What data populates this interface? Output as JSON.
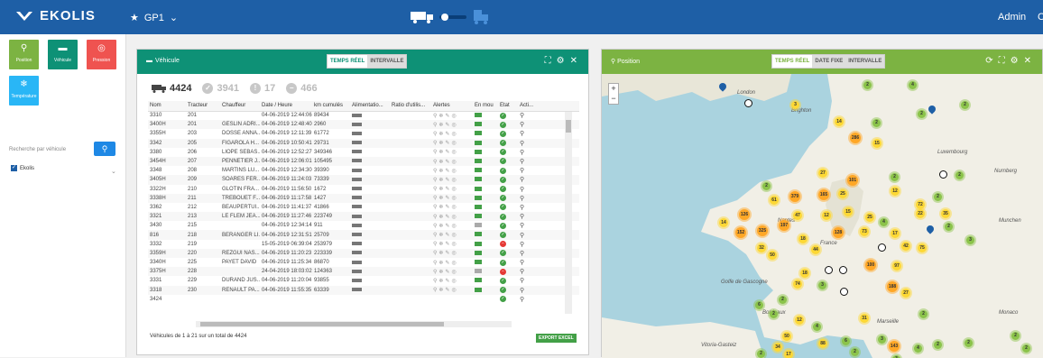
{
  "app": {
    "logo_text": "EKOLIS",
    "favorites": "GP1",
    "user": "Admin",
    "user2": "C"
  },
  "left": {
    "tiles": [
      {
        "label": "Position",
        "color": "#7cb342"
      },
      {
        "label": "Véhicule",
        "color": "#0e9176"
      },
      {
        "label": "Pression",
        "color": "#ef5350"
      },
      {
        "label": "Température",
        "color": "#29b6f6"
      }
    ],
    "search_placeholder": "Recherche par véhicule",
    "group": "Ekolis"
  },
  "vehicles": {
    "title": "Véhicule",
    "tab_realtime": "TEMPS RÉEL",
    "tab_interval": "INTERVALLE",
    "counts": {
      "total": "4424",
      "ok": "3941",
      "alert": "17",
      "off": "466"
    },
    "columns": [
      "Nom",
      "Tracteur",
      "Chauffeur",
      "Date / Heure",
      "km cumulés",
      "Alimentatio...",
      "Ratio d'utilis...",
      "Alertes",
      "En mou",
      "Etat",
      "Acti..."
    ],
    "rows": [
      [
        "3310",
        "201",
        "",
        "04-06-2019 12:44:06",
        "89434",
        "g",
        "ok"
      ],
      [
        "3400H",
        "201",
        "GESLIN ADRI...",
        "04-06-2019 12:48:40",
        "2960",
        "g",
        "ok"
      ],
      [
        "3355H",
        "203",
        "DOSSE ANNA...",
        "04-06-2019 12:11:39",
        "61772",
        "g",
        "ok"
      ],
      [
        "3342",
        "205",
        "FIGAROLA H...",
        "04-06-2019 10:50:41",
        "29731",
        "g",
        "ok"
      ],
      [
        "3380",
        "206",
        "LIOPE SEBAS...",
        "04-06-2019 12:52:27",
        "349346",
        "g",
        "ok"
      ],
      [
        "3454H",
        "207",
        "PENNETIER J...",
        "04-06-2019 12:06:01",
        "105495",
        "g",
        "ok"
      ],
      [
        "3348",
        "208",
        "MARTINS LU...",
        "04-06-2019 12:34:30",
        "39390",
        "g",
        "ok"
      ],
      [
        "3405H",
        "209",
        "SOARES FER...",
        "04-06-2019 11:24:03",
        "73339",
        "g",
        "ok"
      ],
      [
        "3322H",
        "210",
        "GLOTIN FRA...",
        "04-06-2019 11:56:50",
        "1672",
        "g",
        "ok"
      ],
      [
        "3338H",
        "211",
        "TREBOUET F...",
        "04-06-2019 11:17:58",
        "1427",
        "g",
        "ok"
      ],
      [
        "3362",
        "212",
        "BEAUPERTUI...",
        "04-06-2019 11:41:37",
        "41866",
        "g",
        "ok"
      ],
      [
        "3321",
        "213",
        "LE FLEM JEA...",
        "04-06-2019 11:27:46",
        "223749",
        "g",
        "ok"
      ],
      [
        "3430",
        "215",
        "",
        "04-06-2019 12:34:14",
        "911",
        "n",
        "ok"
      ],
      [
        "816",
        "218",
        "BERANGER LI...",
        "04-06-2019 12:31:51",
        "25709",
        "g",
        "ok"
      ],
      [
        "3332",
        "219",
        "",
        "15-05-2019 06:39:04",
        "253979",
        "g",
        "r"
      ],
      [
        "3359H",
        "220",
        "REZGUI NAS...",
        "04-06-2019 11:20:23",
        "223339",
        "g",
        "ok"
      ],
      [
        "3340H",
        "225",
        "PAYET DAVID",
        "04-06-2019 11:25:34",
        "86870",
        "g",
        "ok"
      ],
      [
        "3375H",
        "228",
        "",
        "24-04-2019 18:03:02",
        "124363",
        "n",
        "r"
      ],
      [
        "3331",
        "229",
        "DURAND JUS...",
        "04-06-2019 11:20:04",
        "93855",
        "g",
        "ok"
      ],
      [
        "3318",
        "230",
        "RENAULT PA...",
        "04-06-2019 11:55:35",
        "63339",
        "g",
        "ok"
      ],
      [
        "3424",
        "",
        "",
        "",
        "",
        "",
        "ok"
      ]
    ],
    "footer": "Véhicules de 1 à 21 sur un total de 4424",
    "export": "EXPORT EXCEL"
  },
  "map": {
    "title": "Position",
    "tab_realtime": "TEMPS RÉEL",
    "tab_fixed": "DATE FIXE",
    "tab_interval": "INTERVALLE",
    "labels": [
      "London",
      "Brighton",
      "Golfe de Gascogne",
      "Bordeaux",
      "Marseille",
      "France",
      "Nantes",
      "Nurnberg",
      "Munchen",
      "Monaco",
      "Vitoria-Gasteiz",
      "Luxembourg"
    ],
    "clusters": [
      {
        "t": "2",
        "c": "gr"
      },
      {
        "t": "4",
        "c": "gr"
      },
      {
        "t": "3",
        "c": "y"
      },
      {
        "t": "14",
        "c": "y"
      },
      {
        "t": "2",
        "c": "gr"
      },
      {
        "t": "286",
        "c": "o"
      },
      {
        "t": "15",
        "c": "y"
      },
      {
        "t": "2",
        "c": "gr"
      },
      {
        "t": "2",
        "c": "gr"
      },
      {
        "t": "27",
        "c": "y"
      },
      {
        "t": "101",
        "c": "o"
      },
      {
        "t": "2",
        "c": "gr"
      },
      {
        "t": "12",
        "c": "y"
      },
      {
        "t": "2",
        "c": "gr"
      },
      {
        "t": "61",
        "c": "y"
      },
      {
        "t": "379",
        "c": "o"
      },
      {
        "t": "165",
        "c": "o"
      },
      {
        "t": "25",
        "c": "y"
      },
      {
        "t": "2",
        "c": "gr"
      },
      {
        "t": "72",
        "c": "y"
      },
      {
        "t": "2",
        "c": "gr"
      },
      {
        "t": "35",
        "c": "y"
      },
      {
        "t": "14",
        "c": "y"
      },
      {
        "t": "152",
        "c": "o"
      },
      {
        "t": "325",
        "c": "o"
      },
      {
        "t": "197",
        "c": "o"
      },
      {
        "t": "47",
        "c": "y"
      },
      {
        "t": "126",
        "c": "o"
      },
      {
        "t": "12",
        "c": "y"
      },
      {
        "t": "15",
        "c": "y"
      },
      {
        "t": "25",
        "c": "y"
      },
      {
        "t": "4",
        "c": "gr"
      },
      {
        "t": "22",
        "c": "y"
      },
      {
        "t": "18",
        "c": "y"
      },
      {
        "t": "2",
        "c": "gr"
      },
      {
        "t": "3",
        "c": "gr"
      },
      {
        "t": "128",
        "c": "o"
      },
      {
        "t": "73",
        "c": "y"
      },
      {
        "t": "17",
        "c": "y"
      },
      {
        "t": "32",
        "c": "y"
      },
      {
        "t": "50",
        "c": "y"
      },
      {
        "t": "44",
        "c": "y"
      },
      {
        "t": "75",
        "c": "y"
      },
      {
        "t": "100",
        "c": "o"
      },
      {
        "t": "97",
        "c": "y"
      },
      {
        "t": "42",
        "c": "y"
      },
      {
        "t": "18",
        "c": "y"
      },
      {
        "t": "74",
        "c": "y"
      },
      {
        "t": "3",
        "c": "gr"
      },
      {
        "t": "2",
        "c": "gr"
      },
      {
        "t": "6",
        "c": "gr"
      },
      {
        "t": "188",
        "c": "o"
      },
      {
        "t": "27",
        "c": "y"
      },
      {
        "t": "2",
        "c": "gr"
      },
      {
        "t": "12",
        "c": "y"
      },
      {
        "t": "4",
        "c": "gr"
      },
      {
        "t": "31",
        "c": "y"
      },
      {
        "t": "2",
        "c": "gr"
      },
      {
        "t": "3",
        "c": "gr"
      },
      {
        "t": "50",
        "c": "y"
      },
      {
        "t": "6",
        "c": "gr"
      },
      {
        "t": "2",
        "c": "gr"
      },
      {
        "t": "34",
        "c": "y"
      },
      {
        "t": "2",
        "c": "gr"
      },
      {
        "t": "88",
        "c": "y"
      },
      {
        "t": "4",
        "c": "gr"
      },
      {
        "t": "2",
        "c": "gr"
      },
      {
        "t": "143",
        "c": "o"
      },
      {
        "t": "17",
        "c": "y"
      },
      {
        "t": "3",
        "c": "gr"
      },
      {
        "t": "2",
        "c": "gr"
      },
      {
        "t": "2",
        "c": "gr"
      },
      {
        "t": "2",
        "c": "gr"
      }
    ]
  }
}
